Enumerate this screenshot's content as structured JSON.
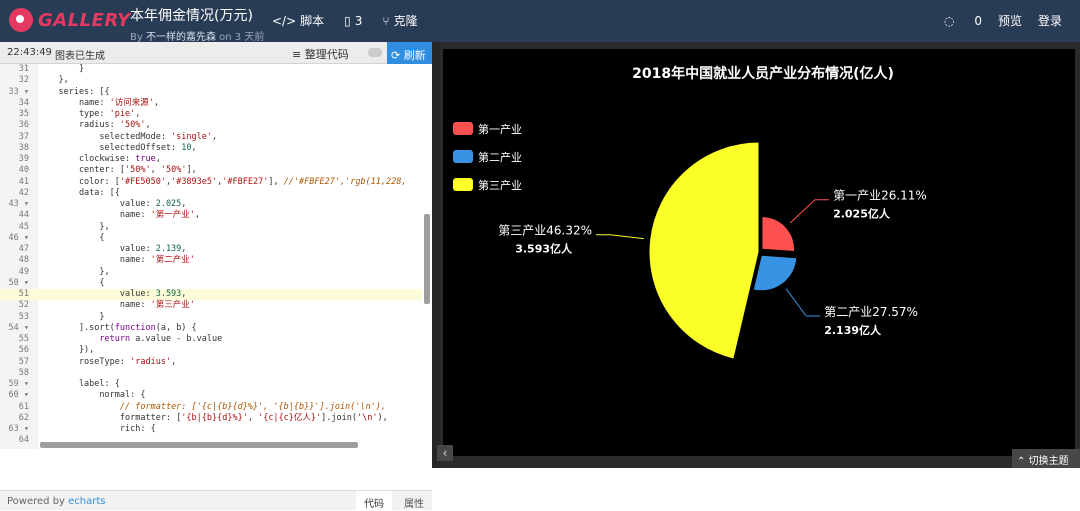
{
  "header": {
    "logo_text": "GALLERY",
    "title": "本年佣金情况(万元)",
    "by": "By",
    "author": "不一样的嘉先森",
    "time_ago": "on 3 天前",
    "script_label": "脚本",
    "fork_count": "3",
    "clone_label": "克隆",
    "comments_count": "0",
    "preview_label": "预览",
    "login_label": "登录"
  },
  "editor": {
    "time": "22:43:49",
    "status": "图表已生成",
    "format_label": "整理代码",
    "run_label": "刷新",
    "line_numbers": [
      "31",
      "32",
      "33",
      "34",
      "35",
      "36",
      "37",
      "38",
      "39",
      "40",
      "41",
      "42",
      "43",
      "44",
      "45",
      "46",
      "47",
      "48",
      "49",
      "50",
      "51",
      "52",
      "53",
      "54",
      "55",
      "56",
      "57",
      "58",
      "59",
      "60",
      "61",
      "62",
      "63",
      "64"
    ],
    "fold_markers": {
      "33": "▾",
      "43": "▾",
      "46": "▾",
      "50": "▾",
      "54": "▾",
      "59": "▾",
      "60": "▾",
      "63": "▾"
    },
    "footer_powered": "Powered by",
    "footer_link": "echarts",
    "tab_code": "代码",
    "tab_props": "属性"
  },
  "theme": {
    "switch_label": "切换主题"
  },
  "chart_data": {
    "type": "pie",
    "title": "2018年中国就业人员产业分布情况(亿人)",
    "rose_type": "radius",
    "legend_position": "left",
    "legend": [
      "第一产业",
      "第二产业",
      "第三产业"
    ],
    "series": [
      {
        "name": "第一产业",
        "value": 2.025,
        "percent": "26.11%",
        "color": "#FE5050"
      },
      {
        "name": "第二产业",
        "value": 2.139,
        "percent": "27.57%",
        "color": "#3893e5"
      },
      {
        "name": "第三产业",
        "value": 3.593,
        "percent": "46.32%",
        "color": "#FBFE27"
      }
    ],
    "value_unit": "亿人",
    "background": "#000000"
  }
}
